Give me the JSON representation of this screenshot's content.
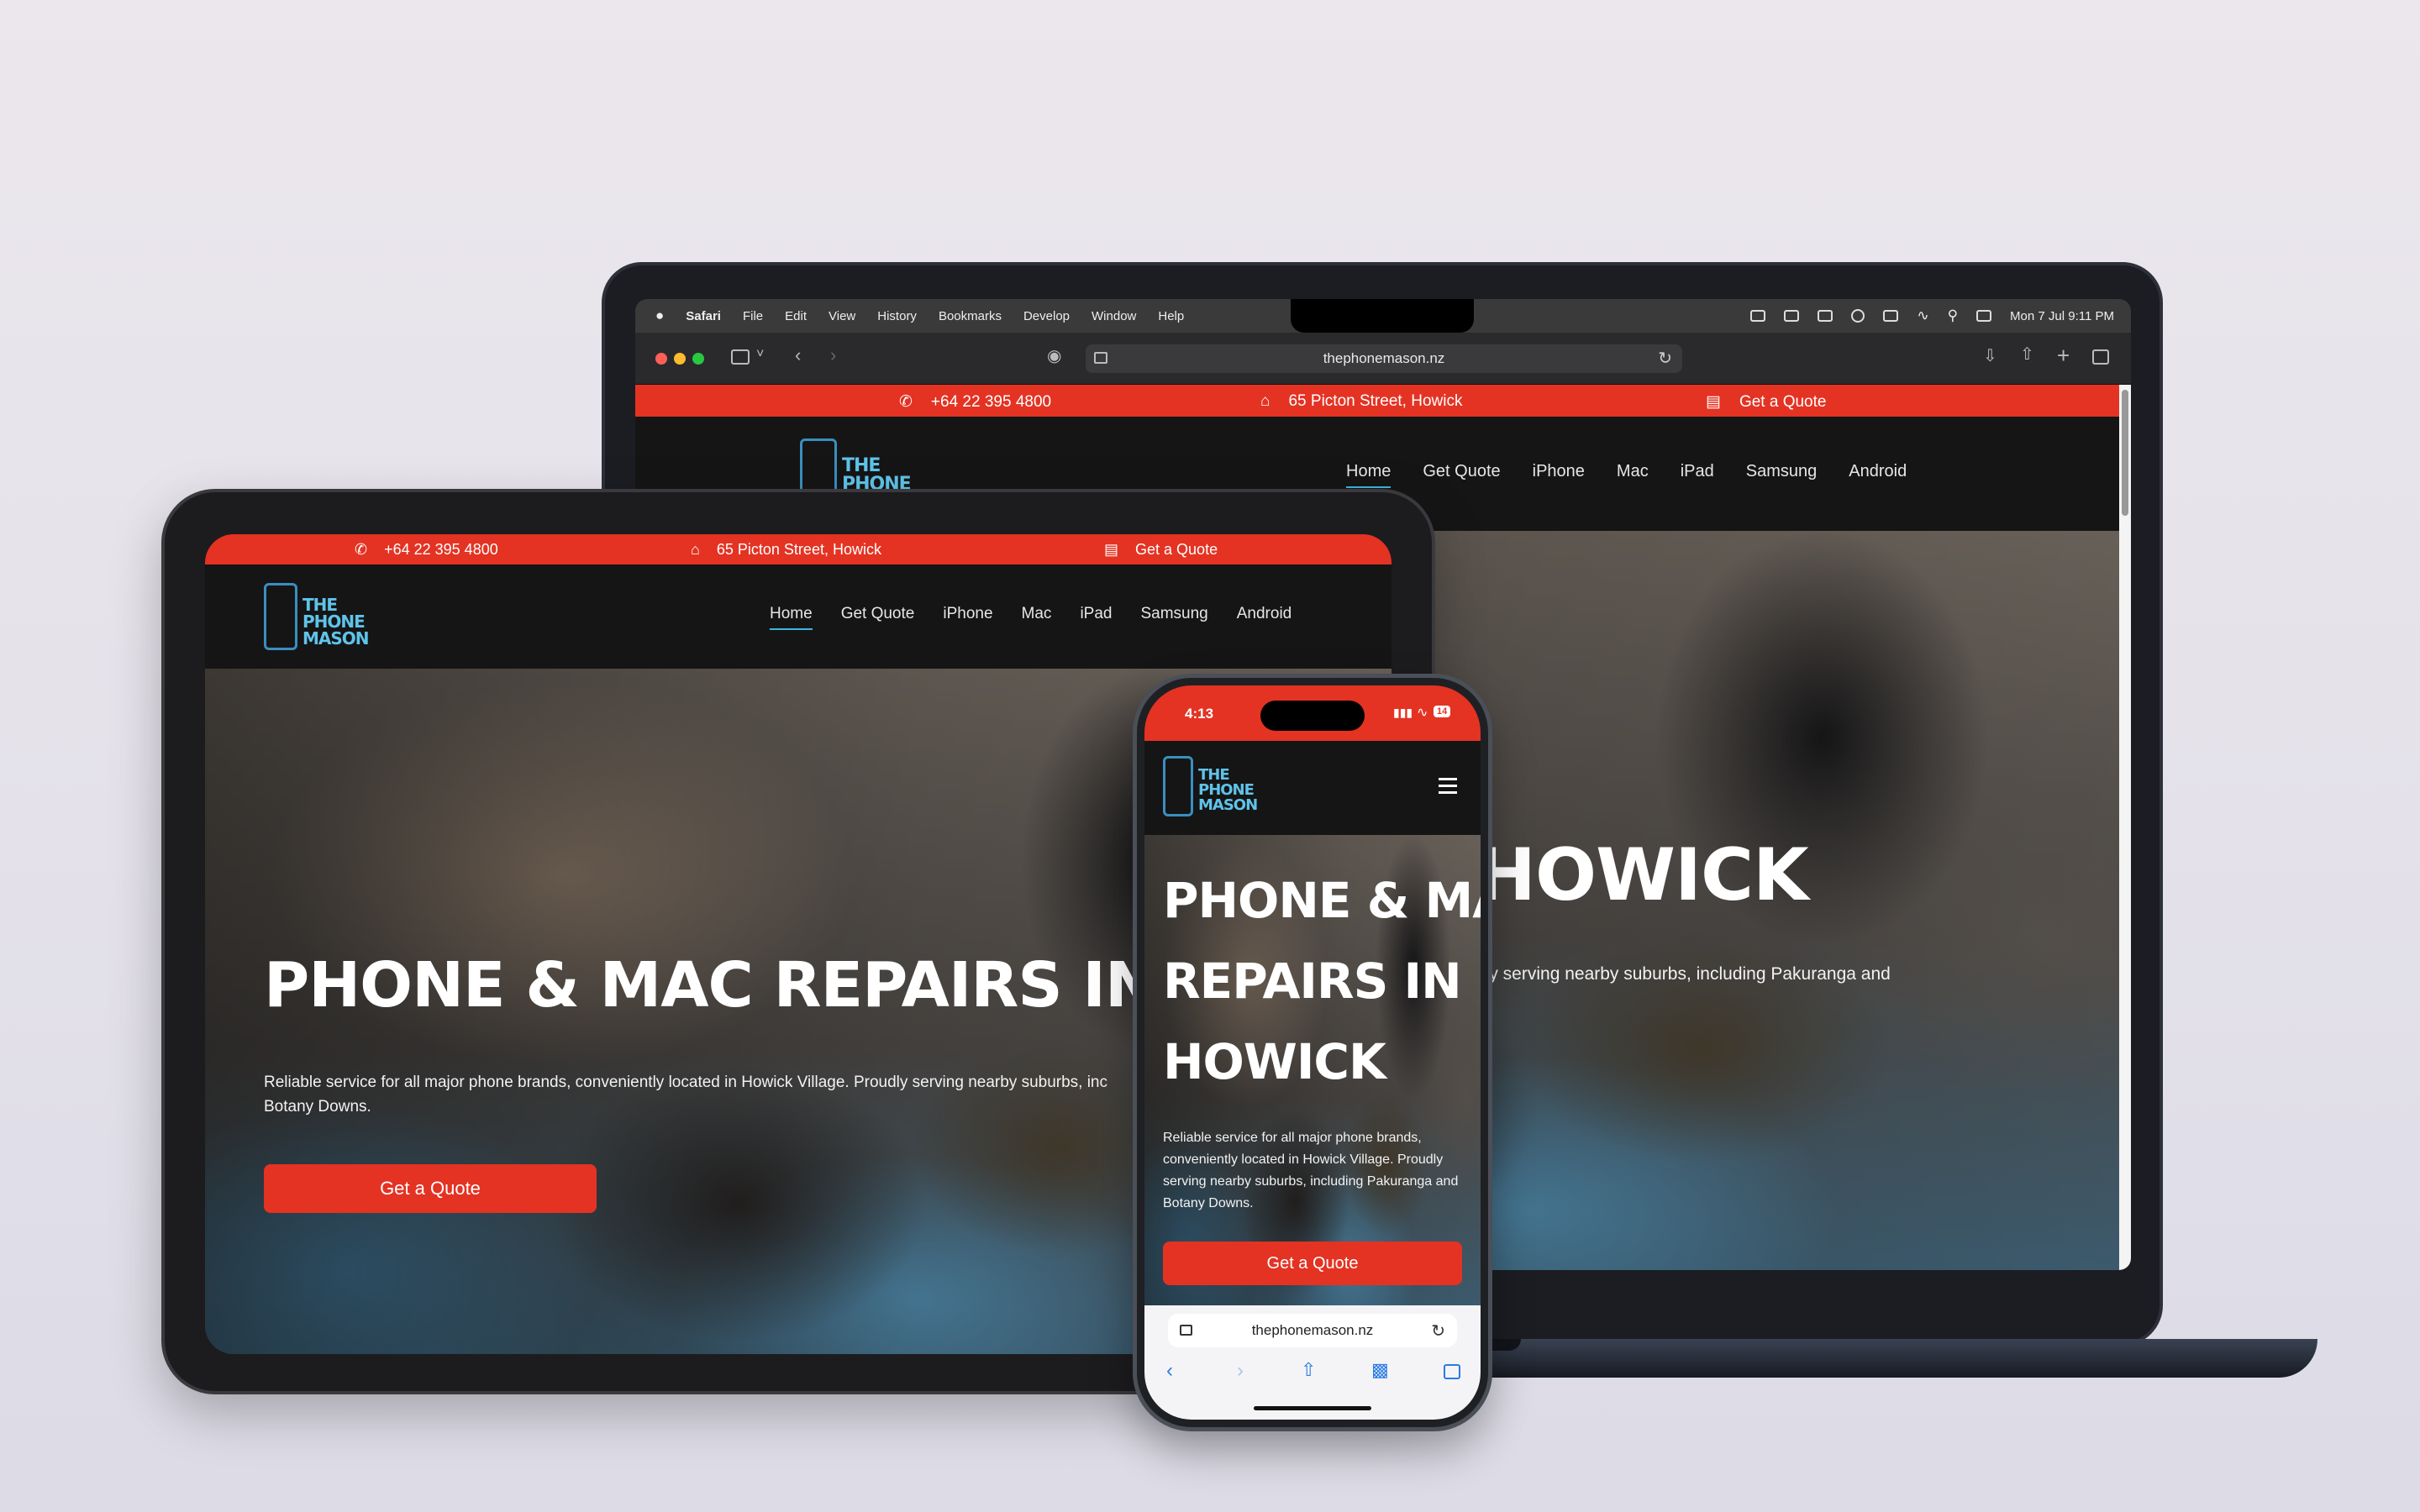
{
  "site": {
    "phone": "+64 22 395 4800",
    "address": "65 Picton Street, Howick",
    "quote_link": "Get a Quote",
    "logo_lines": [
      "THE",
      "PHONE",
      "MASON"
    ],
    "nav": [
      "Home",
      "Get Quote",
      "iPhone",
      "Mac",
      "iPad",
      "Samsung",
      "Android"
    ],
    "hero_title": "PHONE & MAC REPAIRS IN HOWICK",
    "hero_title_mac_visible": "HOWICK",
    "hero_sub": "Reliable service for all major phone brands, conveniently located in Howick Village. Proudly serving nearby suburbs, including Pakuranga and Botany Downs.",
    "hero_sub_ipad_line1": "Reliable service for all major phone brands, conveniently located in Howick Village. Proudly serving nearby suburbs, inc",
    "hero_sub_ipad_line2": "Botany Downs.",
    "hero_sub_mac_visible": "dly serving nearby suburbs, including Pakuranga and",
    "hero_title_phone": [
      "PHONE & MAC",
      "REPAIRS IN",
      "HOWICK"
    ],
    "cta": "Get a Quote",
    "colors": {
      "brand_red": "#e43323",
      "logo_blue": "#5fc3ea",
      "nav_bg": "#151515"
    }
  },
  "macos": {
    "app": "Safari",
    "menus": [
      "File",
      "Edit",
      "View",
      "History",
      "Bookmarks",
      "Develop",
      "Window",
      "Help"
    ],
    "clock": "Mon 7 Jul  9:11 PM",
    "url": "thephonemason.nz"
  },
  "iphone": {
    "time": "4:13",
    "battery": "14",
    "url": "thephonemason.nz",
    "menu_icon": "hamburger-icon"
  }
}
